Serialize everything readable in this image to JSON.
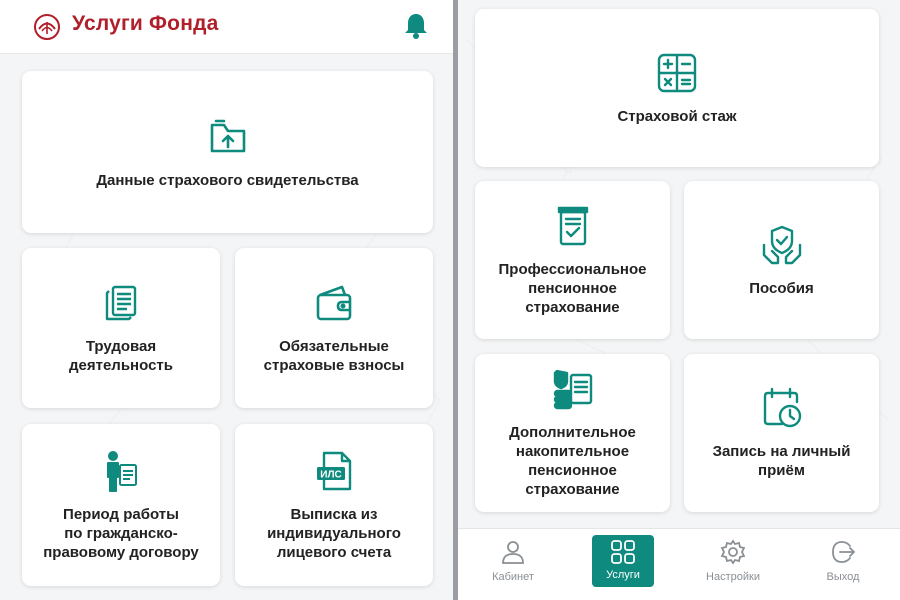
{
  "header": {
    "title": "Услуги Фонда"
  },
  "left_cards": [
    {
      "label": "Данные страхового свидетельства",
      "icon": "folder-upload-icon"
    },
    {
      "label": "Трудовая\nдеятельность",
      "icon": "documents-icon"
    },
    {
      "label": "Обязательные\nстраховые взносы",
      "icon": "wallet-icon"
    },
    {
      "label": "Период работы\nпо гражданско-\nправовому договору",
      "icon": "person-document-icon"
    },
    {
      "label": "Выписка из\nиндивидуального\nлицевого счета",
      "icon": "ils-document-icon",
      "icon_text": "ИЛС"
    }
  ],
  "right_cards": [
    {
      "label": "Страховой стаж",
      "icon": "calculator-icon"
    },
    {
      "label": "Профессиональное\nпенсионное\nстрахование",
      "icon": "document-check-icon"
    },
    {
      "label": "Пособия",
      "icon": "hands-shield-icon"
    },
    {
      "label": "Дополнительное\nнакопительное\nпенсионное\nстрахование",
      "icon": "coins-document-icon"
    },
    {
      "label": "Запись на личный\nприём",
      "icon": "calendar-clock-icon"
    }
  ],
  "nav": [
    {
      "label": "Кабинет",
      "icon": "person-icon",
      "active": false
    },
    {
      "label": "Услуги",
      "icon": "grid-icon",
      "active": true
    },
    {
      "label": "Настройки",
      "icon": "gear-icon",
      "active": false
    },
    {
      "label": "Выход",
      "icon": "exit-icon",
      "active": false
    }
  ],
  "colors": {
    "accent": "#0e8a7e",
    "brand": "#b01f2a",
    "text": "#222222",
    "muted": "#8a8f94"
  }
}
